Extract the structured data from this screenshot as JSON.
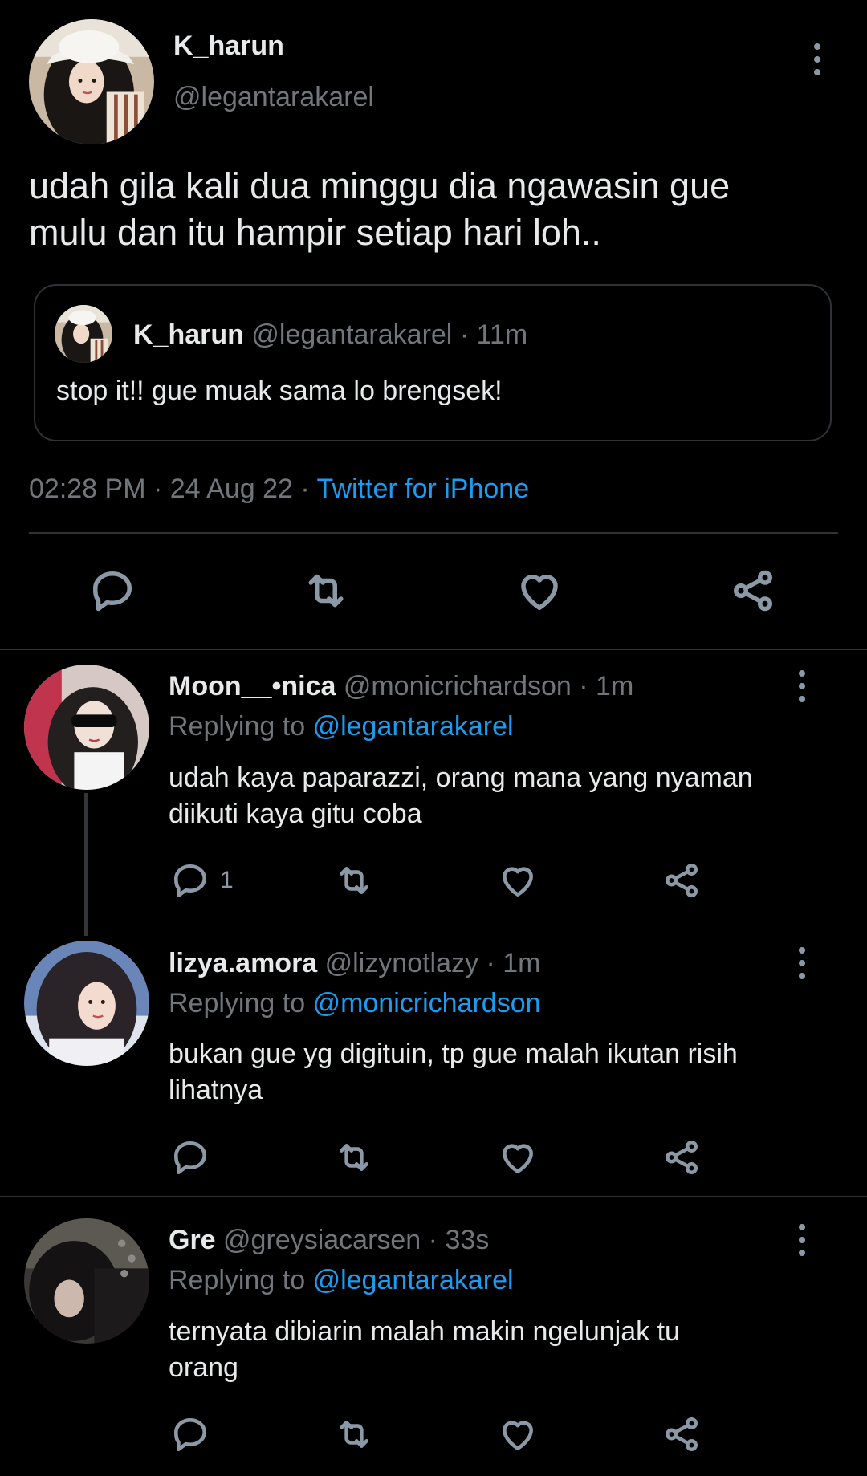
{
  "main_tweet": {
    "display_name": "K_harun",
    "handle": "@legantarakarel",
    "text_line1": "udah gila kali dua minggu dia ngawasin gue",
    "text_line2": "mulu dan itu hampir setiap hari loh..",
    "quoted": {
      "display_name": "K_harun",
      "handle": "@legantarakarel",
      "separator": "·",
      "time": "11m",
      "text": "stop it!! gue muak sama lo brengsek!"
    },
    "meta": {
      "time": "02:28 PM",
      "sep1": "·",
      "date": "24 Aug 22",
      "sep2": "·",
      "source": "Twitter for iPhone"
    },
    "actions": [
      "reply-icon",
      "retweet-icon",
      "like-icon",
      "share-icon"
    ]
  },
  "replies": [
    {
      "display_name": "Moon__•nica",
      "handle": "@monicrichardson",
      "separator": "·",
      "time": "1m",
      "replying_prefix": "Replying to",
      "replying_to": "@legantarakarel",
      "text_line1": "udah kaya paparazzi, orang mana yang nyaman",
      "text_line2": "diikuti kaya gitu coba",
      "reply_count": "1"
    },
    {
      "display_name": "lizya.amora",
      "handle": "@lizynotlazy",
      "separator": "·",
      "time": "1m",
      "replying_prefix": "Replying to",
      "replying_to": "@monicrichardson",
      "text_line1": "bukan gue yg digituin, tp gue malah ikutan risih",
      "text_line2": "lihatnya",
      "reply_count": ""
    },
    {
      "display_name": "Gre",
      "handle": "@greysiacarsen",
      "separator": "·",
      "time": "33s",
      "replying_prefix": "Replying to",
      "replying_to": "@legantarakarel",
      "text_line1": "ternyata dibiarin malah makin ngelunjak tu",
      "text_line2": "orang",
      "reply_count": ""
    }
  ],
  "colors": {
    "background": "#000000",
    "text": "#e7e9ea",
    "muted": "#71767b",
    "link": "#1d9bf0",
    "divider": "#2f3336",
    "icon": "#8b98a5"
  }
}
